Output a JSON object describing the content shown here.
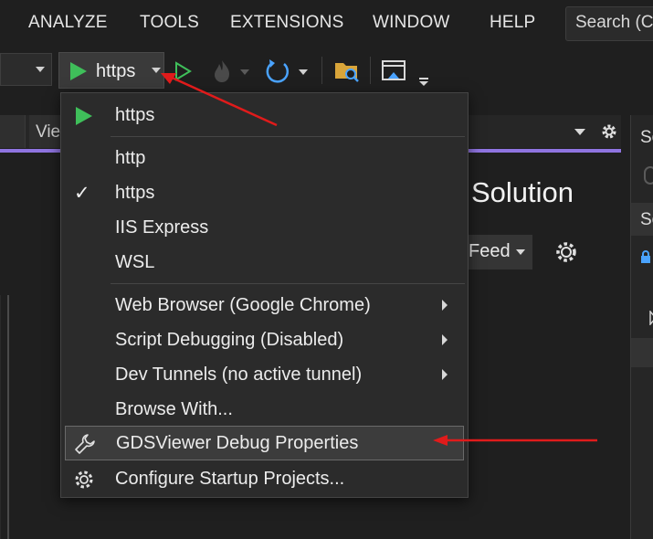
{
  "menubar": {
    "items": [
      "ANALYZE",
      "TOOLS",
      "EXTENSIONS",
      "WINDOW",
      "HELP"
    ],
    "search_label": "Search (C"
  },
  "toolbar": {
    "run_label": "https",
    "icons": [
      "play-icon",
      "play-outline-icon",
      "hot-reload-flame-icon",
      "restart-icon",
      "folder-search-icon",
      "browser-window-icon"
    ]
  },
  "tabs": {
    "view_label": "Vie"
  },
  "main": {
    "solution_title": "Solution",
    "feed_label": "Feed"
  },
  "right_panel": {
    "row1": "So",
    "row2": "So"
  },
  "dropdown": {
    "top_item": "https",
    "profiles": [
      {
        "label": "http",
        "checked": false
      },
      {
        "label": "https",
        "checked": true
      },
      {
        "label": "IIS Express",
        "checked": false
      },
      {
        "label": "WSL",
        "checked": false
      }
    ],
    "check_mark": "✓",
    "submenus": [
      "Web Browser (Google Chrome)",
      "Script Debugging (Disabled)",
      "Dev Tunnels (no active tunnel)"
    ],
    "browse_with": "Browse With...",
    "debug_properties": "GDSViewer Debug Properties",
    "configure_startup": "Configure Startup Projects..."
  },
  "colors": {
    "accent_purple": "#8f74e0",
    "play_green": "#3fbf5a",
    "annotation_red": "#e01b1b",
    "restart_blue": "#4aa3ff"
  }
}
